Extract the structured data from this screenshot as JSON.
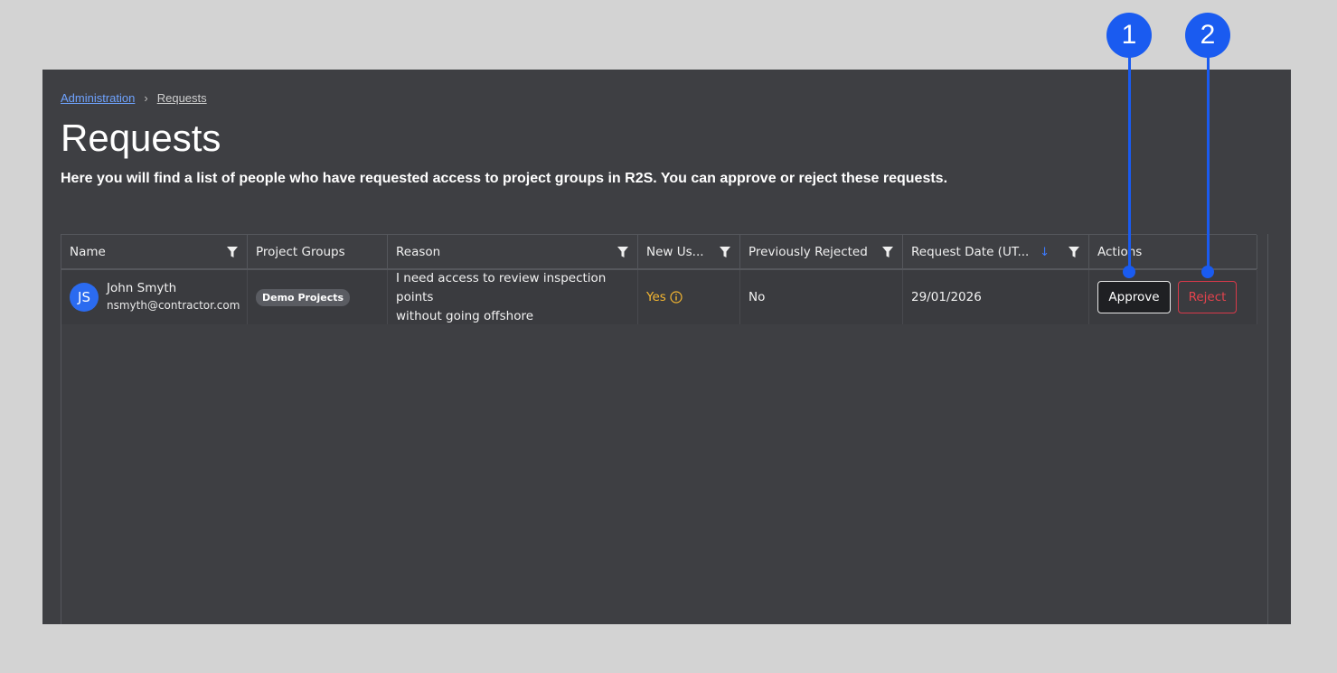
{
  "breadcrumb": {
    "parent": "Administration",
    "separator": "›",
    "current": "Requests"
  },
  "page": {
    "title": "Requests",
    "subtitle": "Here you will find a list of people who have requested access to project groups in R2S. You can approve or reject these requests."
  },
  "table": {
    "columns": {
      "name": "Name",
      "project_groups": "Project Groups",
      "reason": "Reason",
      "new_user": "New Us...",
      "previously_rejected": "Previously Rejected",
      "request_date": "Request Date (UT...",
      "actions": "Actions"
    },
    "rows": [
      {
        "initials": "JS",
        "name": "John Smyth",
        "email": "nsmyth@contractor.com",
        "project_group": "Demo Projects",
        "reason_line1": "I need access to review inspection points",
        "reason_line2": "without going offshore",
        "new_user": "Yes",
        "previously_rejected": "No",
        "request_date": "29/01/2026",
        "approve_label": "Approve",
        "reject_label": "Reject"
      }
    ]
  },
  "callouts": {
    "one": "1",
    "two": "2"
  },
  "colors": {
    "accent": "#1a5bf0",
    "warning": "#f5b731",
    "danger": "#e4434d",
    "panel": "#3e3f43"
  },
  "icons": {
    "filter": "filter-icon",
    "sort": "sort-descending-icon",
    "info": "info-icon"
  }
}
